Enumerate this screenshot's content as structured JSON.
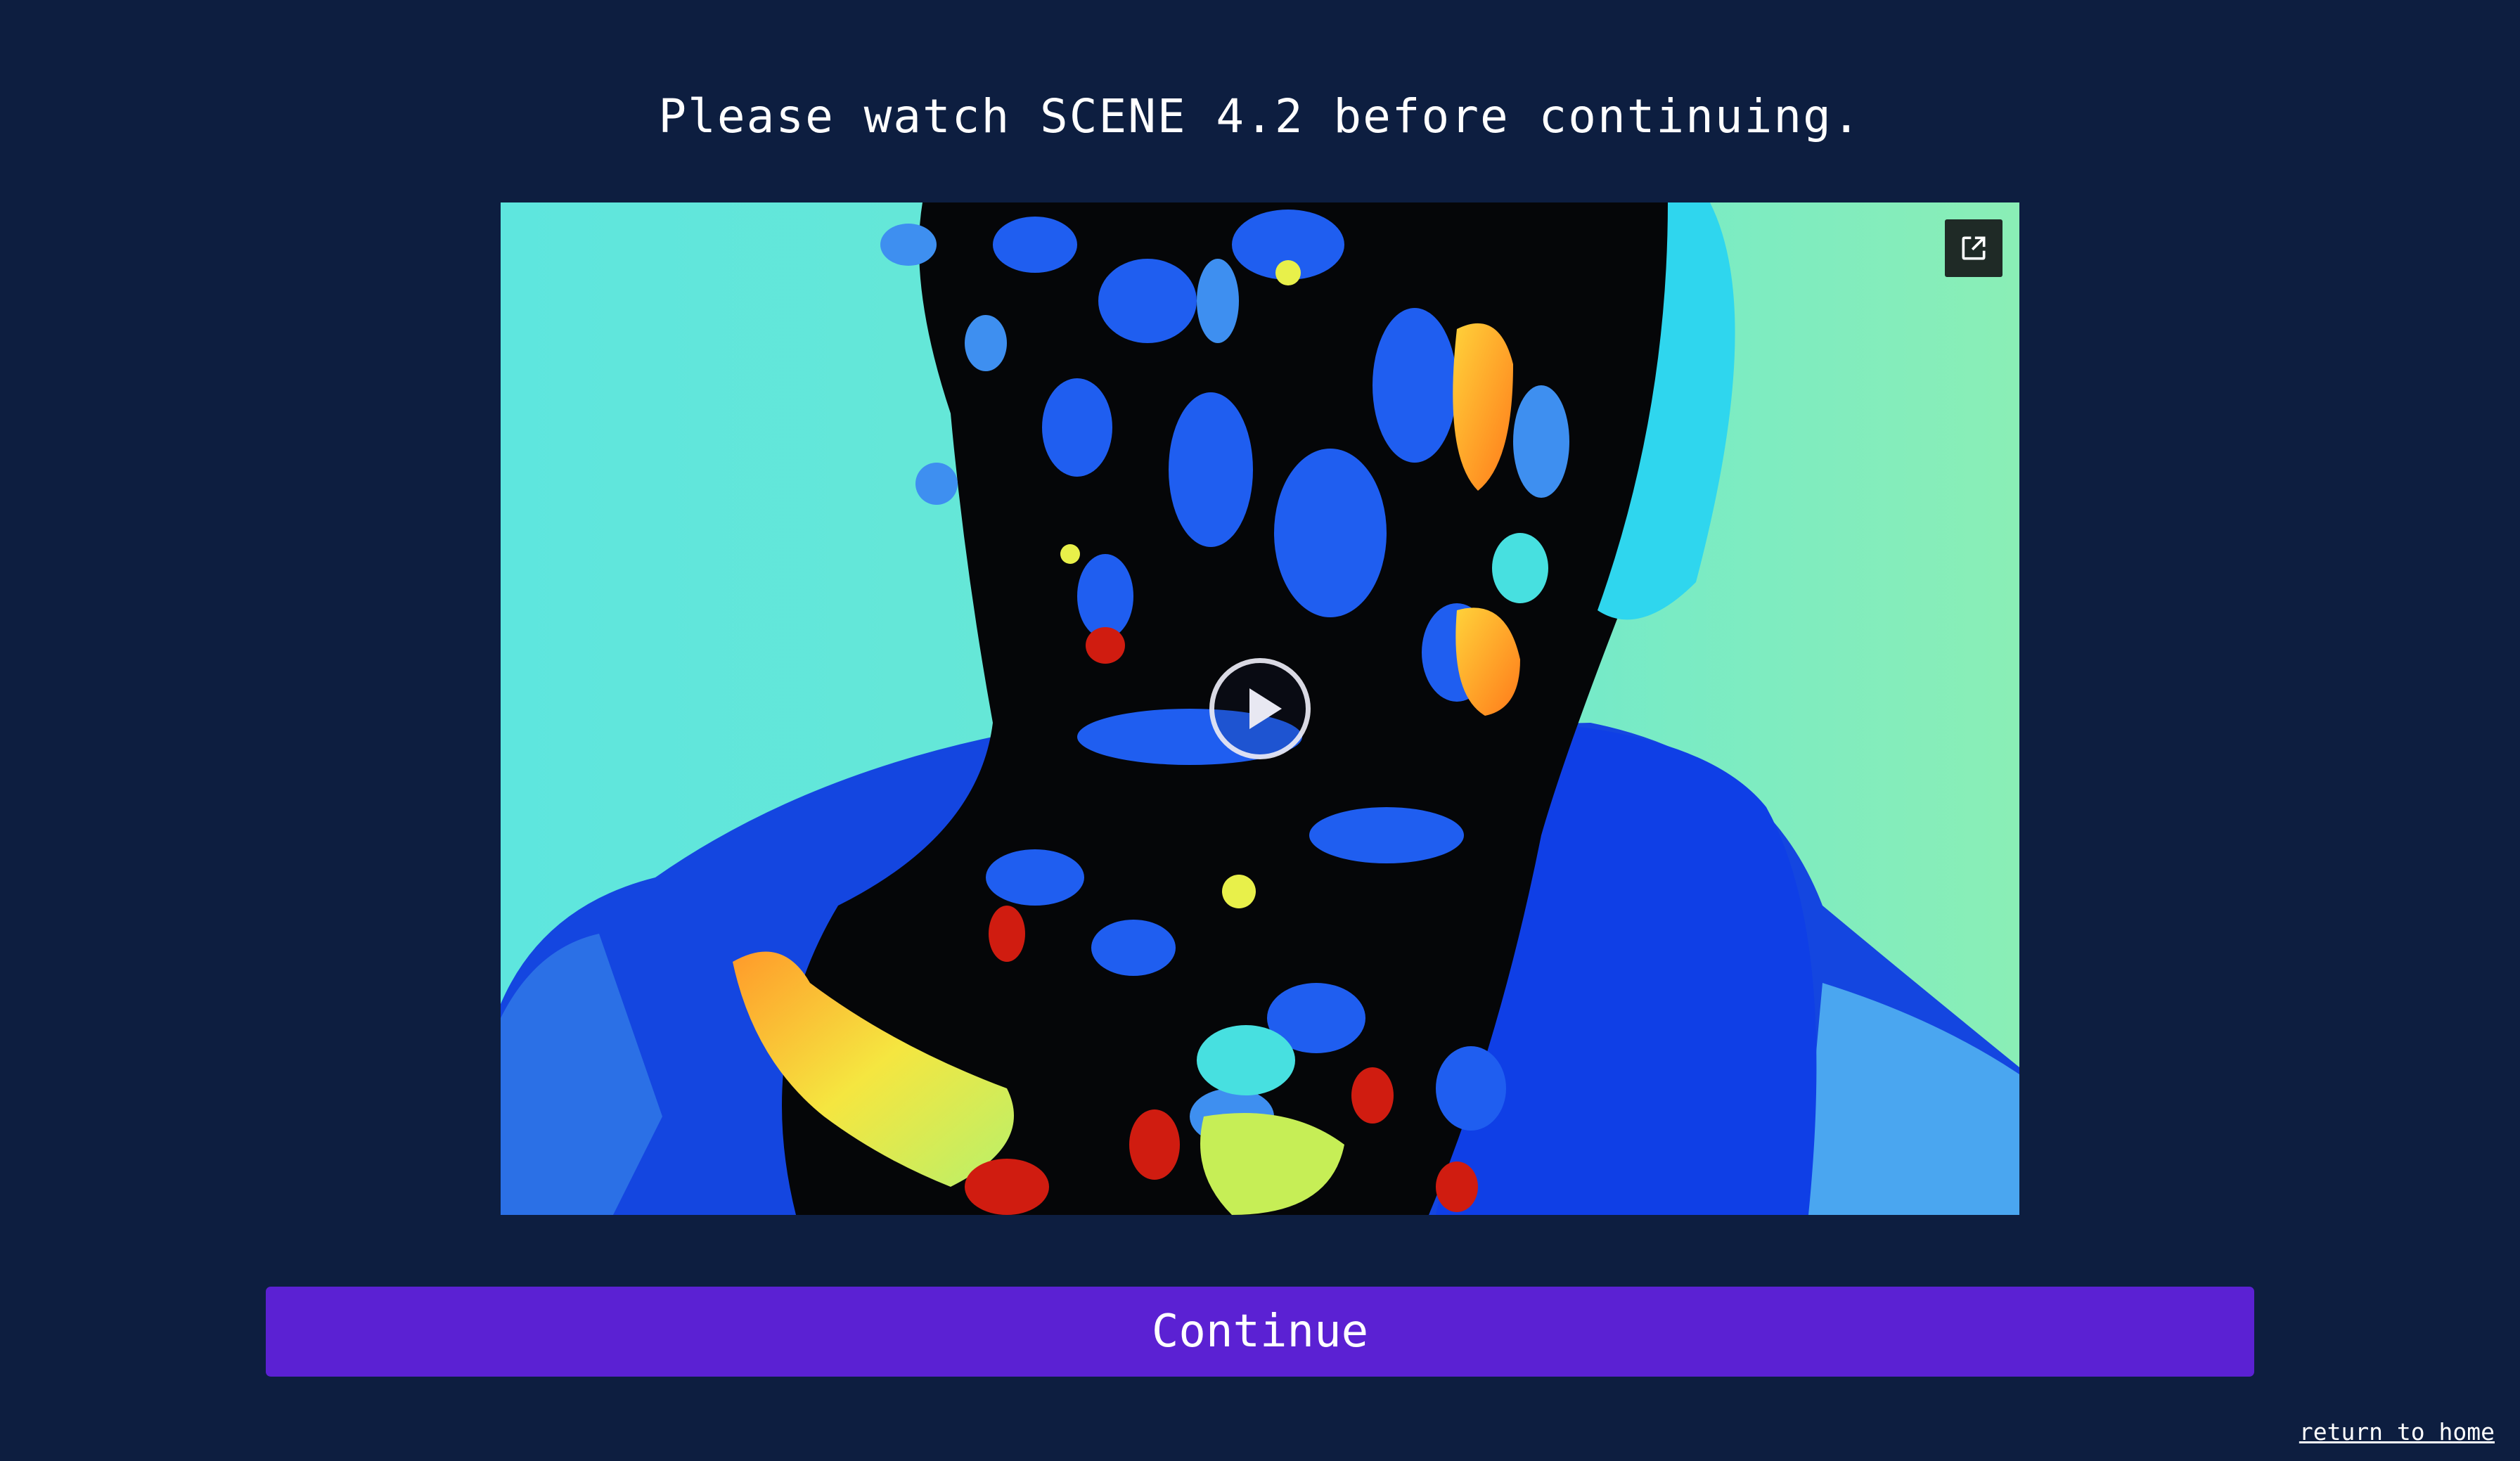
{
  "page": {
    "instruction": "Please watch SCENE 4.2 before continuing.",
    "background_color": "#0d1e40"
  },
  "video": {
    "play_icon": "play-icon",
    "popout_icon": "external-link-icon"
  },
  "actions": {
    "continue_label": "Continue",
    "continue_color": "#5b21d3",
    "home_link_label": "return to home"
  }
}
